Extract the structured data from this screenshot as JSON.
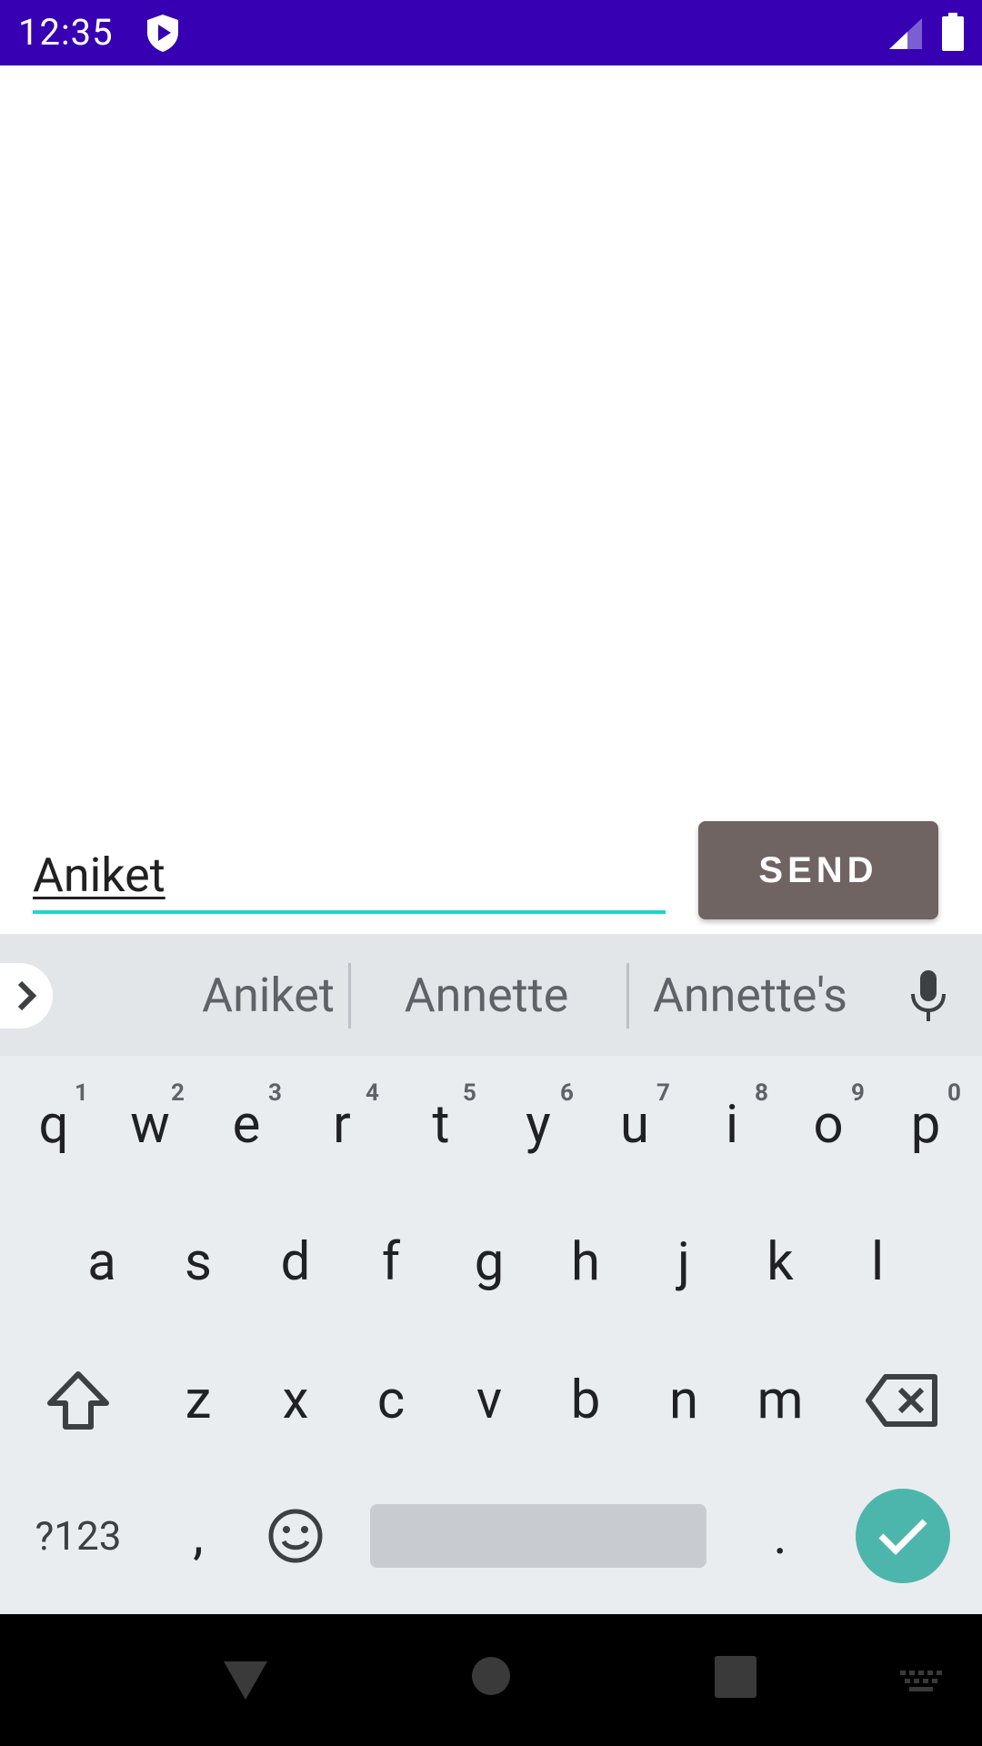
{
  "status_bar": {
    "time": "12:35",
    "icons": [
      "shield-play-icon",
      "signal-icon",
      "battery-icon"
    ]
  },
  "input": {
    "value": "Aniket"
  },
  "send_button": {
    "label": "SEND"
  },
  "suggestions": [
    "Aniket",
    "Annette",
    "Annette's"
  ],
  "keyboard": {
    "row1": [
      {
        "k": "q",
        "h": "1"
      },
      {
        "k": "w",
        "h": "2"
      },
      {
        "k": "e",
        "h": "3"
      },
      {
        "k": "r",
        "h": "4"
      },
      {
        "k": "t",
        "h": "5"
      },
      {
        "k": "y",
        "h": "6"
      },
      {
        "k": "u",
        "h": "7"
      },
      {
        "k": "i",
        "h": "8"
      },
      {
        "k": "o",
        "h": "9"
      },
      {
        "k": "p",
        "h": "0"
      }
    ],
    "row2": [
      "a",
      "s",
      "d",
      "f",
      "g",
      "h",
      "j",
      "k",
      "l"
    ],
    "row3": [
      "z",
      "x",
      "c",
      "v",
      "b",
      "n",
      "m"
    ],
    "symbols_label": "?123",
    "comma": ",",
    "period": "."
  },
  "colors": {
    "status_bar": "#3700b3",
    "send_button": "#706462",
    "input_underline": "#1ed5c8",
    "enter_key": "#4db6ac"
  }
}
